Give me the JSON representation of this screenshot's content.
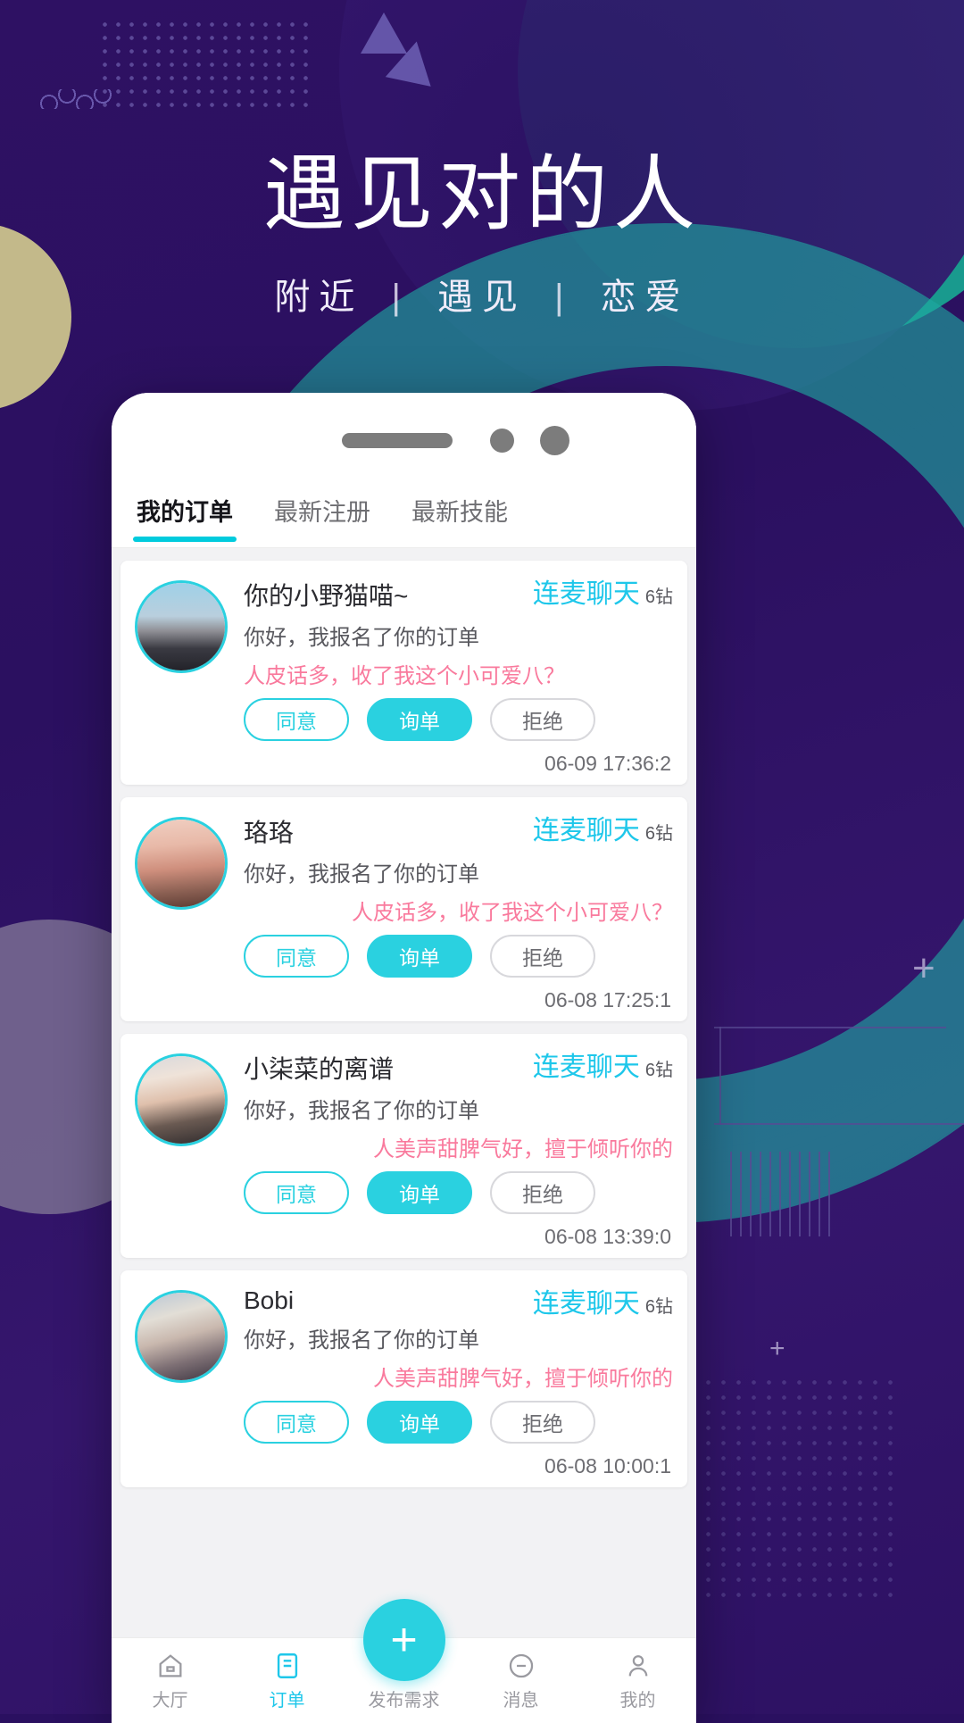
{
  "hero": {
    "title": "遇见对的人",
    "subtitle_parts": [
      "附近",
      "遇见",
      "恋爱"
    ],
    "separator": "|"
  },
  "colors": {
    "background": "#2b1060",
    "teal": "#199a8e",
    "accent_cyan": "#2ad1e0",
    "link_cyan": "#1ec7ea",
    "pink": "#f97a9d",
    "tan": "#c3b98a"
  },
  "app": {
    "tabs": [
      {
        "label": "我的订单",
        "active": true
      },
      {
        "label": "最新注册",
        "active": false
      },
      {
        "label": "最新技能",
        "active": false
      }
    ],
    "buttons": {
      "agree": "同意",
      "ask": "询单",
      "reject": "拒绝"
    },
    "orders": [
      {
        "name": "你的小野猫喵~",
        "message": "你好，我报名了你的订单",
        "tagline": "人皮话多，收了我这个小可爱八？",
        "tagline_align": "left",
        "service": "连麦聊天",
        "price": "6钻",
        "timestamp": "06-09 17:36:2",
        "avatar_theme": "avatar-1"
      },
      {
        "name": "珞珞",
        "message": "你好，我报名了你的订单",
        "tagline": "人皮话多，收了我这个小可爱八？",
        "tagline_align": "right",
        "service": "连麦聊天",
        "price": "6钻",
        "timestamp": "06-08 17:25:1",
        "avatar_theme": "avatar-2"
      },
      {
        "name": "小柒菜的离谱",
        "message": "你好，我报名了你的订单",
        "tagline": "人美声甜脾气好，擅于倾听你的",
        "tagline_align": "right",
        "service": "连麦聊天",
        "price": "6钻",
        "timestamp": "06-08 13:39:0",
        "avatar_theme": "avatar-3"
      },
      {
        "name": "Bobi",
        "message": "你好，我报名了你的订单",
        "tagline": "人美声甜脾气好，擅于倾听你的",
        "tagline_align": "right",
        "service": "连麦聊天",
        "price": "6钻",
        "timestamp": "06-08 10:00:1",
        "avatar_theme": "avatar-4"
      }
    ],
    "bottom_nav": [
      {
        "label": "大厅",
        "icon": "home-icon",
        "active": false
      },
      {
        "label": "订单",
        "icon": "order-icon",
        "active": true
      },
      {
        "label": "发布需求",
        "icon": "plus-icon",
        "active": false
      },
      {
        "label": "消息",
        "icon": "message-icon",
        "active": false
      },
      {
        "label": "我的",
        "icon": "person-icon",
        "active": false
      }
    ],
    "fab_label": "+"
  }
}
